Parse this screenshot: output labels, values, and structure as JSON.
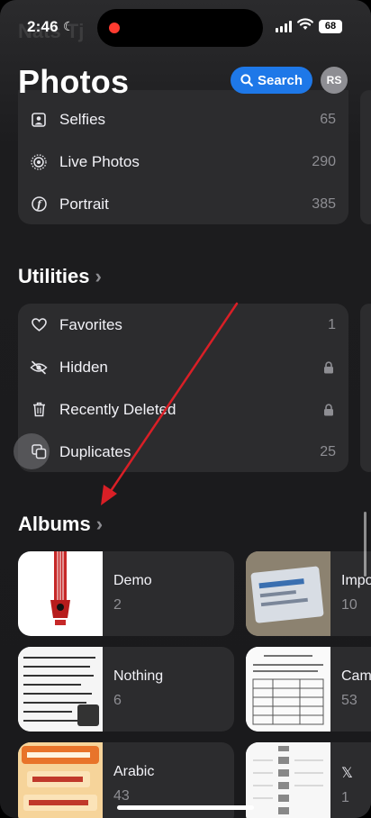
{
  "status_bar": {
    "time": "2:46",
    "battery": "68"
  },
  "header": {
    "title": "Photos",
    "search_label": "Search",
    "avatar_initials": "RS"
  },
  "media_types": [
    {
      "label": "Selfies",
      "count": "65",
      "icon": "selfie-icon"
    },
    {
      "label": "Live Photos",
      "count": "290",
      "icon": "live-photo-icon"
    },
    {
      "label": "Portrait",
      "count": "385",
      "icon": "portrait-icon"
    }
  ],
  "utilities": {
    "title": "Utilities",
    "items": [
      {
        "label": "Favorites",
        "count": "1",
        "icon": "heart-icon"
      },
      {
        "label": "Hidden",
        "count": "",
        "icon": "eye-slash-icon",
        "locked": true
      },
      {
        "label": "Recently Deleted",
        "count": "",
        "icon": "trash-icon",
        "locked": true
      },
      {
        "label": "Duplicates",
        "count": "25",
        "icon": "duplicate-icon"
      }
    ]
  },
  "albums": {
    "title": "Albums",
    "items": [
      {
        "name": "Demo",
        "count": "2"
      },
      {
        "name": "Impo",
        "count": "10"
      },
      {
        "name": "Nothing",
        "count": "6"
      },
      {
        "name": "Cam",
        "count": "53"
      },
      {
        "name": "Arabic",
        "count": "43"
      },
      {
        "name": "𝕏",
        "count": "1"
      }
    ]
  },
  "annotation": {
    "color": "#d91f26"
  },
  "colors": {
    "accent": "#1e78e8",
    "background": "#1c1c1e",
    "card": "#2c2c2e",
    "secondary_text": "#8e8e93"
  }
}
